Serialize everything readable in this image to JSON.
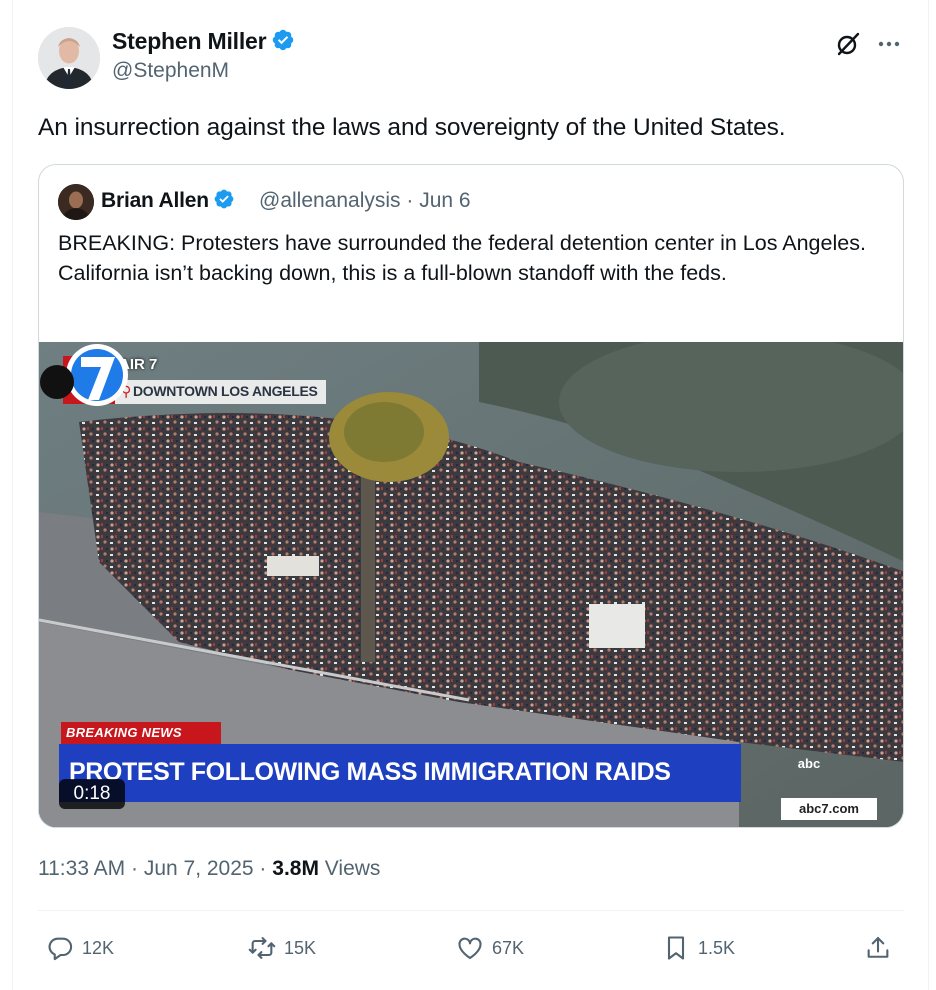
{
  "author": {
    "name": "Stephen Miller",
    "handle": "@StephenM",
    "avatar_icon": "person-avatar"
  },
  "tweet": {
    "text": "An insurrection against the laws and sovereignty of the United States."
  },
  "quoted": {
    "name": "Brian Allen",
    "handle_date": "@allenanalysis · Jun 6",
    "text": "BREAKING: Protesters have surrounded the federal detention center in Los Angeles. California isn’t backing down, this is a full-blown standoff with the feds.",
    "video": {
      "live": "LIVE",
      "air": "AIR 7",
      "location": "DOWNTOWN LOS ANGELES",
      "breaking": "BREAKING NEWS",
      "headline": "PROTEST FOLLOWING MASS IMMIGRATION RAIDS",
      "network": "abc",
      "network_url": "abc7.com",
      "duration": "0:18"
    }
  },
  "meta": {
    "time_date": "11:33 AM · Jun 7, 2025 · ",
    "views_count": "3.8M",
    "views_label": " Views"
  },
  "actions": {
    "replies": "12K",
    "reposts": "15K",
    "likes": "67K",
    "bookmarks": "1.5K"
  },
  "colors": {
    "verified": "#1d9bf0",
    "text": "#0f1419",
    "secondary": "#536471",
    "breaking_red": "#c8161d",
    "headline_blue": "#1e3fbf"
  }
}
